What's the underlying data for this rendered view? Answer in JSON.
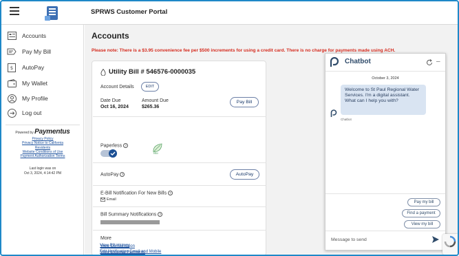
{
  "header": {
    "title": "SPRWS Customer Portal"
  },
  "sidebar": {
    "items": [
      {
        "label": "Accounts",
        "icon": "accounts-icon"
      },
      {
        "label": "Pay My Bill",
        "icon": "pay-bill-icon"
      },
      {
        "label": "AutoPay",
        "icon": "autopay-icon"
      },
      {
        "label": "My Wallet",
        "icon": "wallet-icon"
      },
      {
        "label": "My Profile",
        "icon": "profile-icon"
      },
      {
        "label": "Log out",
        "icon": "logout-icon"
      }
    ],
    "powered_by": "Powered by",
    "brand": "Paymentus",
    "links": [
      "Privacy Policy",
      "Privacy Notice to California",
      "Residents",
      "Website Conditions of Use",
      "Payment Authorization Terms"
    ],
    "last_login_label": "Last login was on",
    "last_login_value": "Oct 3, 2024, 4:14:42 PM"
  },
  "main": {
    "title": "Accounts",
    "notice": "Please note: There is a $3.95 convenience fee per $500 increments for using a credit card. There is no charge for payments made using ACH."
  },
  "bill": {
    "title": "Utility Bill # 546576-0000035",
    "account_details": "Account Details",
    "edit": "EDIT",
    "date_due_label": "Date Due",
    "date_due": "Oct 16, 2024",
    "amount_due_label": "Amount Due",
    "amount_due": "$265.36",
    "pay_bill": "Pay Bill",
    "paperless": "Paperless",
    "ebill_badge": "eBill",
    "autopay_label": "AutoPay",
    "autopay_button": "AutoPay",
    "ebill_notification": "E-Bill Notification For New Bills",
    "email": "Email",
    "bill_summary": "Bill Summary Notifications",
    "more": "More",
    "links": [
      "View Consumption",
      "View External Payments",
      "View Bill History",
      "Edit Notification Email and Mobile"
    ],
    "paperless_enabled": true
  },
  "chatbot": {
    "title": "Chatbot",
    "date": "October 3, 2024",
    "message": "Welcome to St Paul Regional Water Services.          I'm a digital assistant. What can I help you with?",
    "bot_name": "Chatbot",
    "quick_replies": [
      "Pay my bill",
      "Find a payment",
      "View my bill"
    ],
    "input_placeholder": "Message to send"
  },
  "colors": {
    "notice_red": "#d52b1e",
    "link_blue": "#1a4f9c",
    "toggle_blue": "#1b4f94",
    "chat_bubble": "#d9e4f2",
    "frame_blue": "#1e88c8"
  }
}
